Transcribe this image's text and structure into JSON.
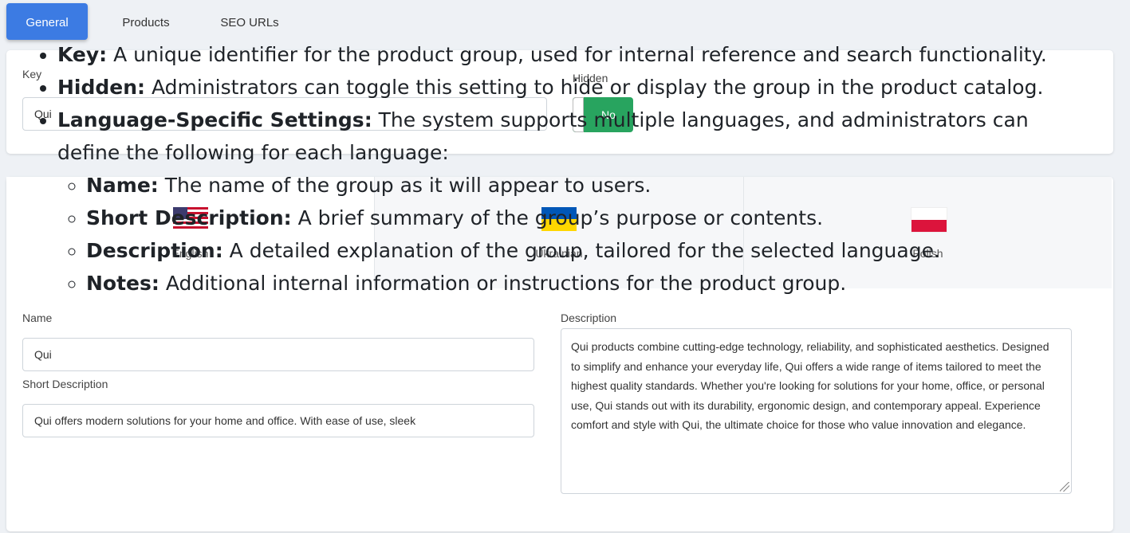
{
  "tabs": [
    {
      "label": "General",
      "active": true
    },
    {
      "label": "Products",
      "active": false
    },
    {
      "label": "SEO URLs",
      "active": false
    }
  ],
  "general": {
    "key_label": "Key",
    "key_value": "Qui",
    "hidden_label": "Hidden",
    "hidden_value": "No"
  },
  "languages": [
    {
      "name": "English",
      "flag": "us-flag-icon"
    },
    {
      "name": "Ukrainian",
      "flag": "ua-flag-icon"
    },
    {
      "name": "Polish",
      "flag": "pl-flag-icon"
    }
  ],
  "localized": {
    "name_label": "Name",
    "name_value": "Qui",
    "short_label": "Short Description",
    "short_value": "Qui offers modern solutions for your home and office. With ease of use, sleek",
    "desc_label": "Description",
    "desc_value": "Qui products combine cutting-edge technology, reliability, and sophisticated aesthetics. Designed to simplify and enhance your everyday life, Qui offers a wide range of items tailored to meet the highest quality standards. Whether you're looking for solutions for your home, office, or personal use, Qui stands out with its durability, ergonomic design, and contemporary appeal. Experience comfort and style with Qui, the ultimate choice for those who value innovation and elegance."
  },
  "overlay": {
    "items": [
      {
        "term": "Key:",
        "text": " A unique identifier for the product group, used for internal reference and search functionality."
      },
      {
        "term": "Hidden:",
        "text": " Administrators can toggle this setting to hide or display the group in the product catalog."
      },
      {
        "term": "Language-Specific Settings:",
        "text": " The system supports multiple languages, and administrators can define the following for each language:"
      }
    ],
    "subitems": [
      {
        "term": "Name:",
        "text": " The name of the group as it will appear to users."
      },
      {
        "term": "Short Description:",
        "text": " A brief summary of the group’s purpose or contents."
      },
      {
        "term": "Description:",
        "text": " A detailed explanation of the group, tailored for the selected language."
      },
      {
        "term": "Notes:",
        "text": " Additional internal information or instructions for the product group."
      }
    ]
  },
  "colors": {
    "accent": "#3c7be3",
    "toggle": "#28a45f",
    "background": "#eef1f5"
  }
}
